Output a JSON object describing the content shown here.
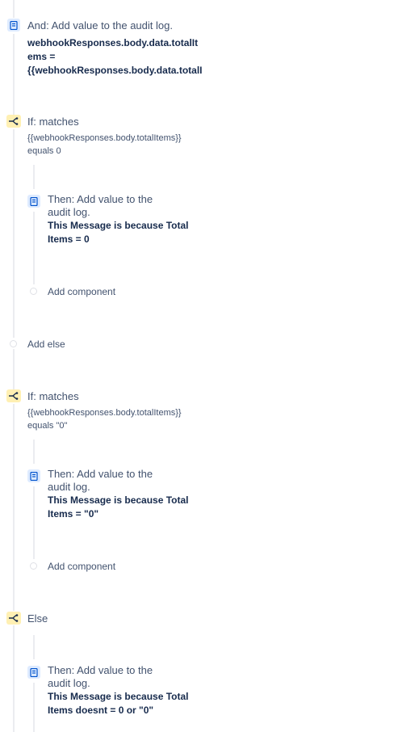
{
  "steps": {
    "audit1": {
      "title": "And: Add value to the audit log.",
      "line1": "webhookResponses.body.data.totalIt",
      "line2": "ems =",
      "line3": "{{webhookResponses.body.data.totalI"
    },
    "if1": {
      "title": "If: matches",
      "expr": "{{webhookResponses.body.totalItems}}",
      "cond": "equals 0",
      "then": {
        "title1": "Then: Add value to the",
        "title2": "audit log.",
        "msg1": "This Message is because Total",
        "msg2": "Items = 0"
      },
      "add_component": "Add component"
    },
    "add_else": "Add else",
    "if2": {
      "title": "If: matches",
      "expr": "{{webhookResponses.body.totalItems}}",
      "cond": "equals \"0\"",
      "then": {
        "title1": "Then: Add value to the",
        "title2": "audit log.",
        "msg1": "This Message is because Total",
        "msg2": "Items = \"0\""
      },
      "add_component": "Add component"
    },
    "else": {
      "title": "Else",
      "then": {
        "title1": "Then: Add value to the",
        "title2": "audit log.",
        "msg1": "This Message is because Total",
        "msg2": "Items doesnt = 0 or \"0\""
      }
    }
  },
  "icons": {
    "action": "audit-log-icon",
    "condition": "branch-icon"
  },
  "colors": {
    "action_bg": "#deebff",
    "action_fg": "#0052cc",
    "condition_bg": "#fff0b3",
    "condition_fg": "#172b4d",
    "connector": "#ebecf0"
  }
}
